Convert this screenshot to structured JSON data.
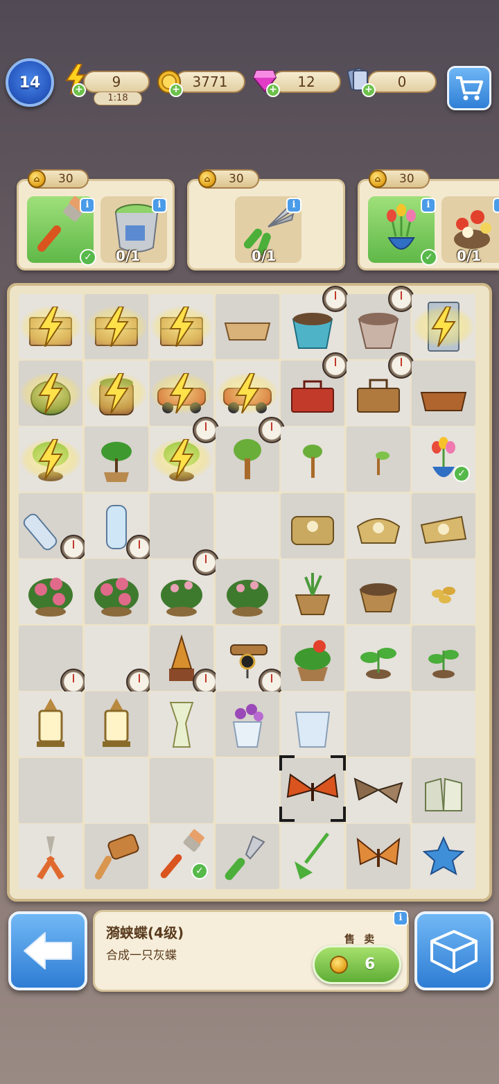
{
  "status_bar": {
    "level": "14",
    "energy": "9",
    "energy_timer": "1:18",
    "coins": "3771",
    "gems": "12",
    "cards": "0"
  },
  "orders": [
    {
      "reward": "30",
      "items": [
        {
          "name": "paintbrush",
          "status": "done"
        },
        {
          "name": "paint-bucket",
          "count": "0/1"
        }
      ]
    },
    {
      "reward": "30",
      "items": [
        {
          "name": "pruning-shears",
          "count": "0/1"
        }
      ]
    },
    {
      "reward": "30",
      "items": [
        {
          "name": "tulip-pot",
          "status": "done"
        },
        {
          "name": "flower-pot",
          "count": "0/1"
        }
      ]
    }
  ],
  "board": {
    "cells": [
      [
        "crate-charged",
        "crate-charged",
        "crate-charged",
        "wooden-tray",
        "planter-with-soil",
        "clay-pot",
        "cabinet-charged"
      ],
      [
        "harvest-basket-charged",
        "barrel-charged",
        "toy-car-charged",
        "toy-car-charged",
        "red-toolbox",
        "wooden-toolbox",
        "tool-tray"
      ],
      [
        "bonsai-charged",
        "sapling-pot",
        "bonsai-charged",
        "small-tree",
        "tree-sprout",
        "seedling",
        "tulip-pot"
      ],
      [
        "water-bottle-tilted",
        "water-bottle",
        "",
        "",
        "seed-bags-stack",
        "seed-bag-open",
        "seed-bag"
      ],
      [
        "peony-bush",
        "peony-bush",
        "peony-bush-small",
        "peony-bush-small",
        "sprout-pot",
        "soil-pot",
        "seeds"
      ],
      [
        "",
        "",
        "spool-lamp",
        "telescope",
        "flower-planter",
        "leafy-sprout",
        "small-sprout"
      ],
      [
        "lantern",
        "lantern",
        "vase",
        "tulip-vase",
        "glass-vase",
        "",
        ""
      ],
      [
        "",
        "",
        "",
        "",
        "red-butterfly",
        "moth",
        "garden-gloves"
      ],
      [
        "pliers",
        "mallet",
        "paintbrush",
        "trowel",
        "rake",
        "orange-butterfly",
        "blue-star"
      ]
    ]
  },
  "selected_item": {
    "name": "漪蛱蝶(4级)",
    "description": "合成一只灰蝶",
    "sell_label": "售 卖",
    "sell_price": "6"
  },
  "colors": {
    "accent_blue": "#2e7cd4",
    "sell_green": "#5fae36",
    "card_bg": "#f3e9cf",
    "text_brown": "#5a3b1e"
  }
}
